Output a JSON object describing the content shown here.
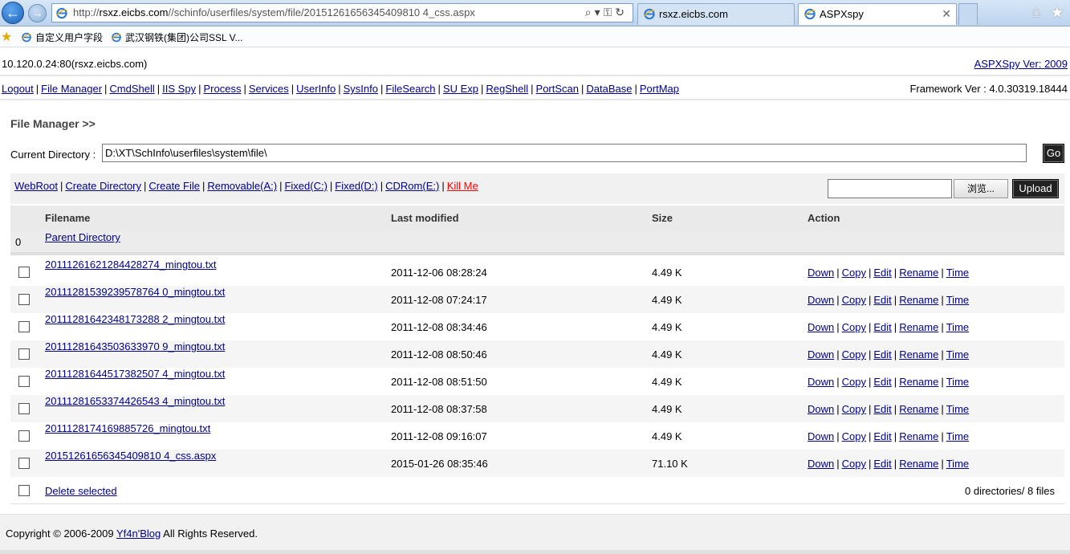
{
  "browser": {
    "address_prefix": "http://",
    "address_domain": "rsxz.eicbs.com",
    "address_path": "//schinfo/userfiles/system/file/20151261656345409810 4_css.aspx",
    "address_full": "http://rsxz.eicbs.com//schinfo/userfiles/system/file/20151261656345409810 4_css.aspx",
    "tabs": [
      {
        "label": "rsxz.eicbs.com"
      },
      {
        "label": "ASPXspy"
      }
    ],
    "favorites": [
      {
        "label": "自定义用户字段"
      },
      {
        "label": "武汉钢铁(集团)公司SSL V..."
      }
    ]
  },
  "header": {
    "host": "10.120.0.24:80(rsxz.eicbs.com)",
    "version_link": "ASPXSpy Ver: 2009",
    "framework": "Framework Ver : 4.0.30319.18444"
  },
  "nav": [
    "Logout",
    "File Manager",
    "CmdShell",
    "IIS Spy",
    "Process",
    "Services",
    "UserInfo",
    "SysInfo",
    "FileSearch",
    "SU Exp",
    "RegShell",
    "PortScan",
    "DataBase",
    "PortMap"
  ],
  "file_manager": {
    "title": "File Manager >>",
    "current_directory_label": "Current Directory :",
    "current_directory_value": "D:\\XT\\SchInfo\\userfiles\\system\\file\\",
    "go_label": "Go",
    "toolbar_links": [
      "WebRoot",
      "Create Directory",
      "Create File",
      "Removable(A:)",
      "Fixed(C:)",
      "Fixed(D:)",
      "CDRom(E:)"
    ],
    "kill_label": "Kill Me",
    "browse_label": "浏览...",
    "upload_label": "Upload"
  },
  "table": {
    "headers": [
      "Filename",
      "Last modified",
      "Size",
      "Action"
    ],
    "parent_index": "0",
    "parent_label": "Parent Directory",
    "actions": [
      "Down",
      "Copy",
      "Edit",
      "Rename",
      "Time"
    ],
    "rows": [
      {
        "name": "20111261621284428274_mingtou.txt",
        "modified": "2011-12-06 08:28:24",
        "size": "4.49 K"
      },
      {
        "name": "20111281539239578764 0_mingtou.txt",
        "modified": "2011-12-08 07:24:17",
        "size": "4.49 K"
      },
      {
        "name": "20111281642348173288 2_mingtou.txt",
        "modified": "2011-12-08 08:34:46",
        "size": "4.49 K"
      },
      {
        "name": "20111281643503633970 9_mingtou.txt",
        "modified": "2011-12-08 08:50:46",
        "size": "4.49 K"
      },
      {
        "name": "20111281644517382507 4_mingtou.txt",
        "modified": "2011-12-08 08:51:50",
        "size": "4.49 K"
      },
      {
        "name": "20111281653374426543 4_mingtou.txt",
        "modified": "2011-12-08 08:37:58",
        "size": "4.49 K"
      },
      {
        "name": "2011128174169885726_mingtou.txt",
        "modified": "2011-12-08 09:16:07",
        "size": "4.49 K"
      },
      {
        "name": "20151261656345409810 4_css.aspx",
        "modified": "2015-01-26 08:35:46",
        "size": "71.10 K"
      }
    ],
    "delete_label": "Delete selected",
    "summary": "0 directories/ 8 files"
  },
  "footer": {
    "prefix": "Copyright © 2006-2009",
    "link": "Yf4n'Blog",
    "suffix": "All Rights Reserved."
  }
}
